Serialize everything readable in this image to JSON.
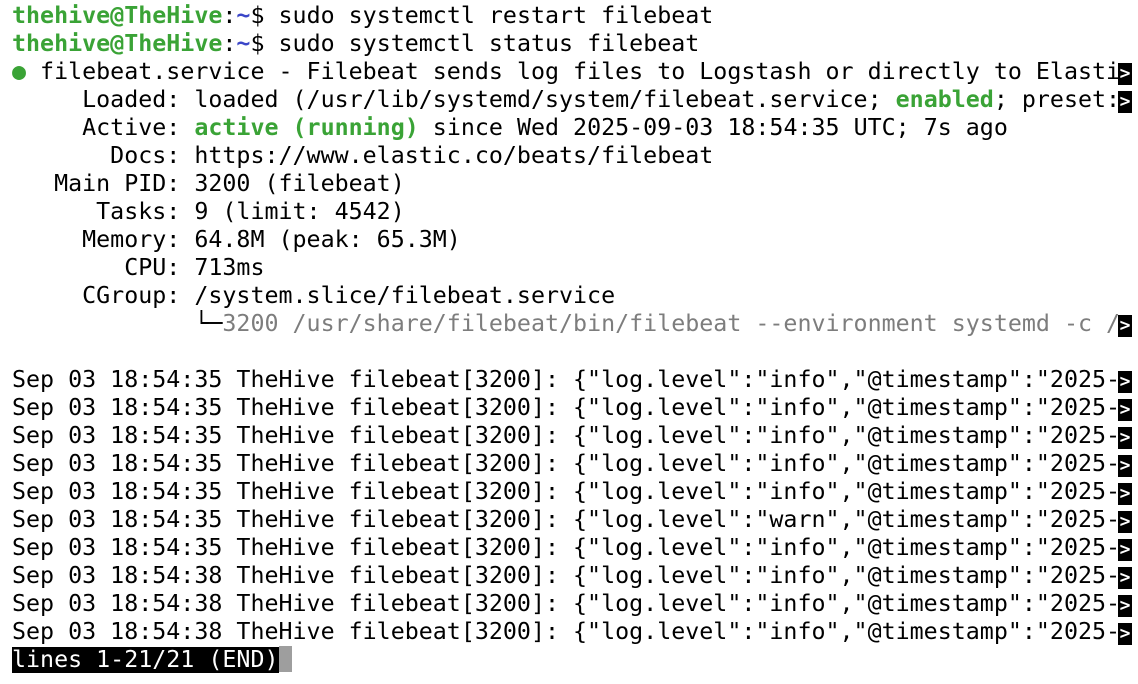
{
  "prompt": {
    "user": "thehive@TheHive",
    "sep": ":",
    "path": "~",
    "symbol": "$ "
  },
  "commands": [
    "sudo systemctl restart filebeat",
    "sudo systemctl status filebeat"
  ],
  "status": {
    "bullet": "●",
    "header": " filebeat.service - Filebeat sends log files to Logstash or directly to Elasti",
    "loaded_label": "     Loaded: ",
    "loaded_pre": "loaded (/usr/lib/systemd/system/filebeat.service; ",
    "loaded_enabled": "enabled",
    "loaded_post": "; preset:",
    "active_label": "     Active: ",
    "active_state": "active (running)",
    "active_post": " since Wed 2025-09-03 18:54:35 UTC; 7s ago",
    "docs": "       Docs: https://www.elastic.co/beats/filebeat",
    "main_pid": "   Main PID: 3200 (filebeat)",
    "tasks": "      Tasks: 9 (limit: 4542)",
    "memory": "     Memory: 64.8M (peak: 65.3M)",
    "cpu": "        CPU: 713ms",
    "cgroup": "     CGroup: /system.slice/filebeat.service",
    "cgroup_tree_prefix": "             └─",
    "cgroup_tree_proc": "3200 /usr/share/filebeat/bin/filebeat --environment systemd -c /"
  },
  "truncation_glyph": ">",
  "log_lines": [
    "Sep 03 18:54:35 TheHive filebeat[3200]: {\"log.level\":\"info\",\"@timestamp\":\"2025-",
    "Sep 03 18:54:35 TheHive filebeat[3200]: {\"log.level\":\"info\",\"@timestamp\":\"2025-",
    "Sep 03 18:54:35 TheHive filebeat[3200]: {\"log.level\":\"info\",\"@timestamp\":\"2025-",
    "Sep 03 18:54:35 TheHive filebeat[3200]: {\"log.level\":\"info\",\"@timestamp\":\"2025-",
    "Sep 03 18:54:35 TheHive filebeat[3200]: {\"log.level\":\"info\",\"@timestamp\":\"2025-",
    "Sep 03 18:54:35 TheHive filebeat[3200]: {\"log.level\":\"warn\",\"@timestamp\":\"2025-",
    "Sep 03 18:54:35 TheHive filebeat[3200]: {\"log.level\":\"info\",\"@timestamp\":\"2025-",
    "Sep 03 18:54:38 TheHive filebeat[3200]: {\"log.level\":\"info\",\"@timestamp\":\"2025-",
    "Sep 03 18:54:38 TheHive filebeat[3200]: {\"log.level\":\"info\",\"@timestamp\":\"2025-",
    "Sep 03 18:54:38 TheHive filebeat[3200]: {\"log.level\":\"info\",\"@timestamp\":\"2025-"
  ],
  "pager_status": "lines 1-21/21 (END)",
  "colors": {
    "prompt_user": "#3aa336",
    "prompt_path": "#3b46c8",
    "active": "#3aa336",
    "tree": "#7d7d7d"
  }
}
